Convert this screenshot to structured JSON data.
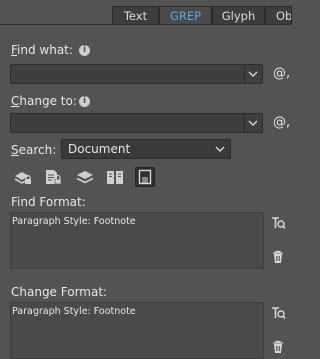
{
  "tabs": [
    {
      "label": "Text",
      "active": false
    },
    {
      "label": "GREP",
      "active": true
    },
    {
      "label": "Glyph",
      "active": false
    },
    {
      "label": "Ob",
      "active": false
    }
  ],
  "find_what": {
    "label": "Find what:",
    "underline_char": "F",
    "label_rest": "ind what:",
    "value": "",
    "special_char_button": "@,"
  },
  "change_to": {
    "label": "Change to:",
    "underline_char": "C",
    "label_rest": "hange to:",
    "value": "",
    "special_char_button": "@,"
  },
  "search": {
    "label_underline": "S",
    "label_rest": "earch:",
    "value": "Document"
  },
  "search_options": [
    {
      "icon": "include-locked-layers-icon",
      "active": false
    },
    {
      "icon": "include-locked-stories-icon",
      "active": false
    },
    {
      "icon": "include-hidden-layers-icon",
      "active": false
    },
    {
      "icon": "include-master-pages-icon",
      "active": false
    },
    {
      "icon": "include-footnotes-icon",
      "active": true
    }
  ],
  "find_format": {
    "label": "Find Format:",
    "value": "Paragraph Style: Footnote"
  },
  "change_format": {
    "label": "Change Format:",
    "value": "Paragraph Style: Footnote"
  },
  "colors": {
    "panel_bg": "#535353",
    "active_tab_text": "#5aa3e6",
    "field_bg": "#3f3f3f"
  }
}
